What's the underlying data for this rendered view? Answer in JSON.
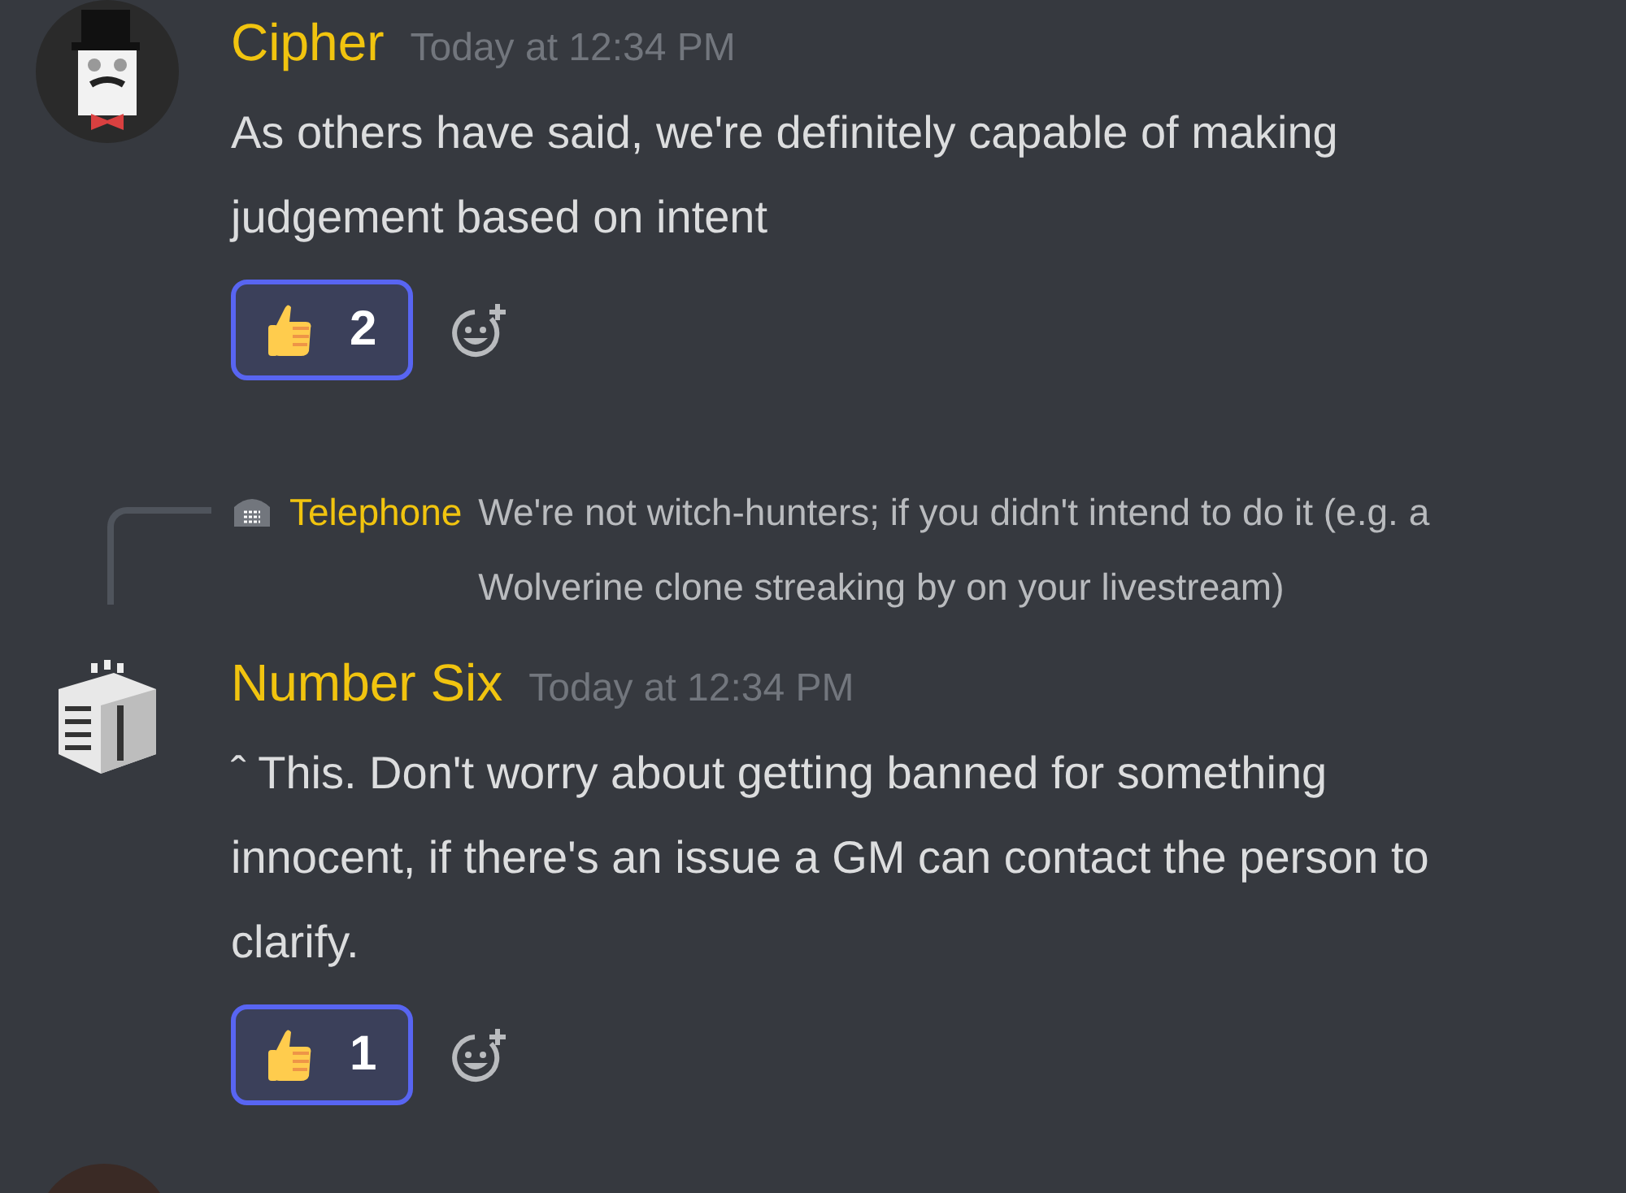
{
  "messages": [
    {
      "author": "Cipher",
      "time": "Today at 12:34 PM",
      "kind": "cipher",
      "text": "As others have said, we're definitely capable of making judgement based on intent",
      "reactions": [
        {
          "count": "2",
          "selected": true
        }
      ]
    },
    {
      "author": "Number Six",
      "time": "Today at 12:34 PM",
      "kind": "cube",
      "reply": {
        "author": "Telephone",
        "text": "We're not witch-hunters; if you didn't intend to do it (e.g. a Wolverine clone streaking by on your livestream)"
      },
      "text": "ˆ This. Don't worry about getting banned for something innocent, if there's an issue a GM can contact the person to clarify.",
      "reactions": [
        {
          "count": "1",
          "selected": true
        }
      ]
    }
  ]
}
